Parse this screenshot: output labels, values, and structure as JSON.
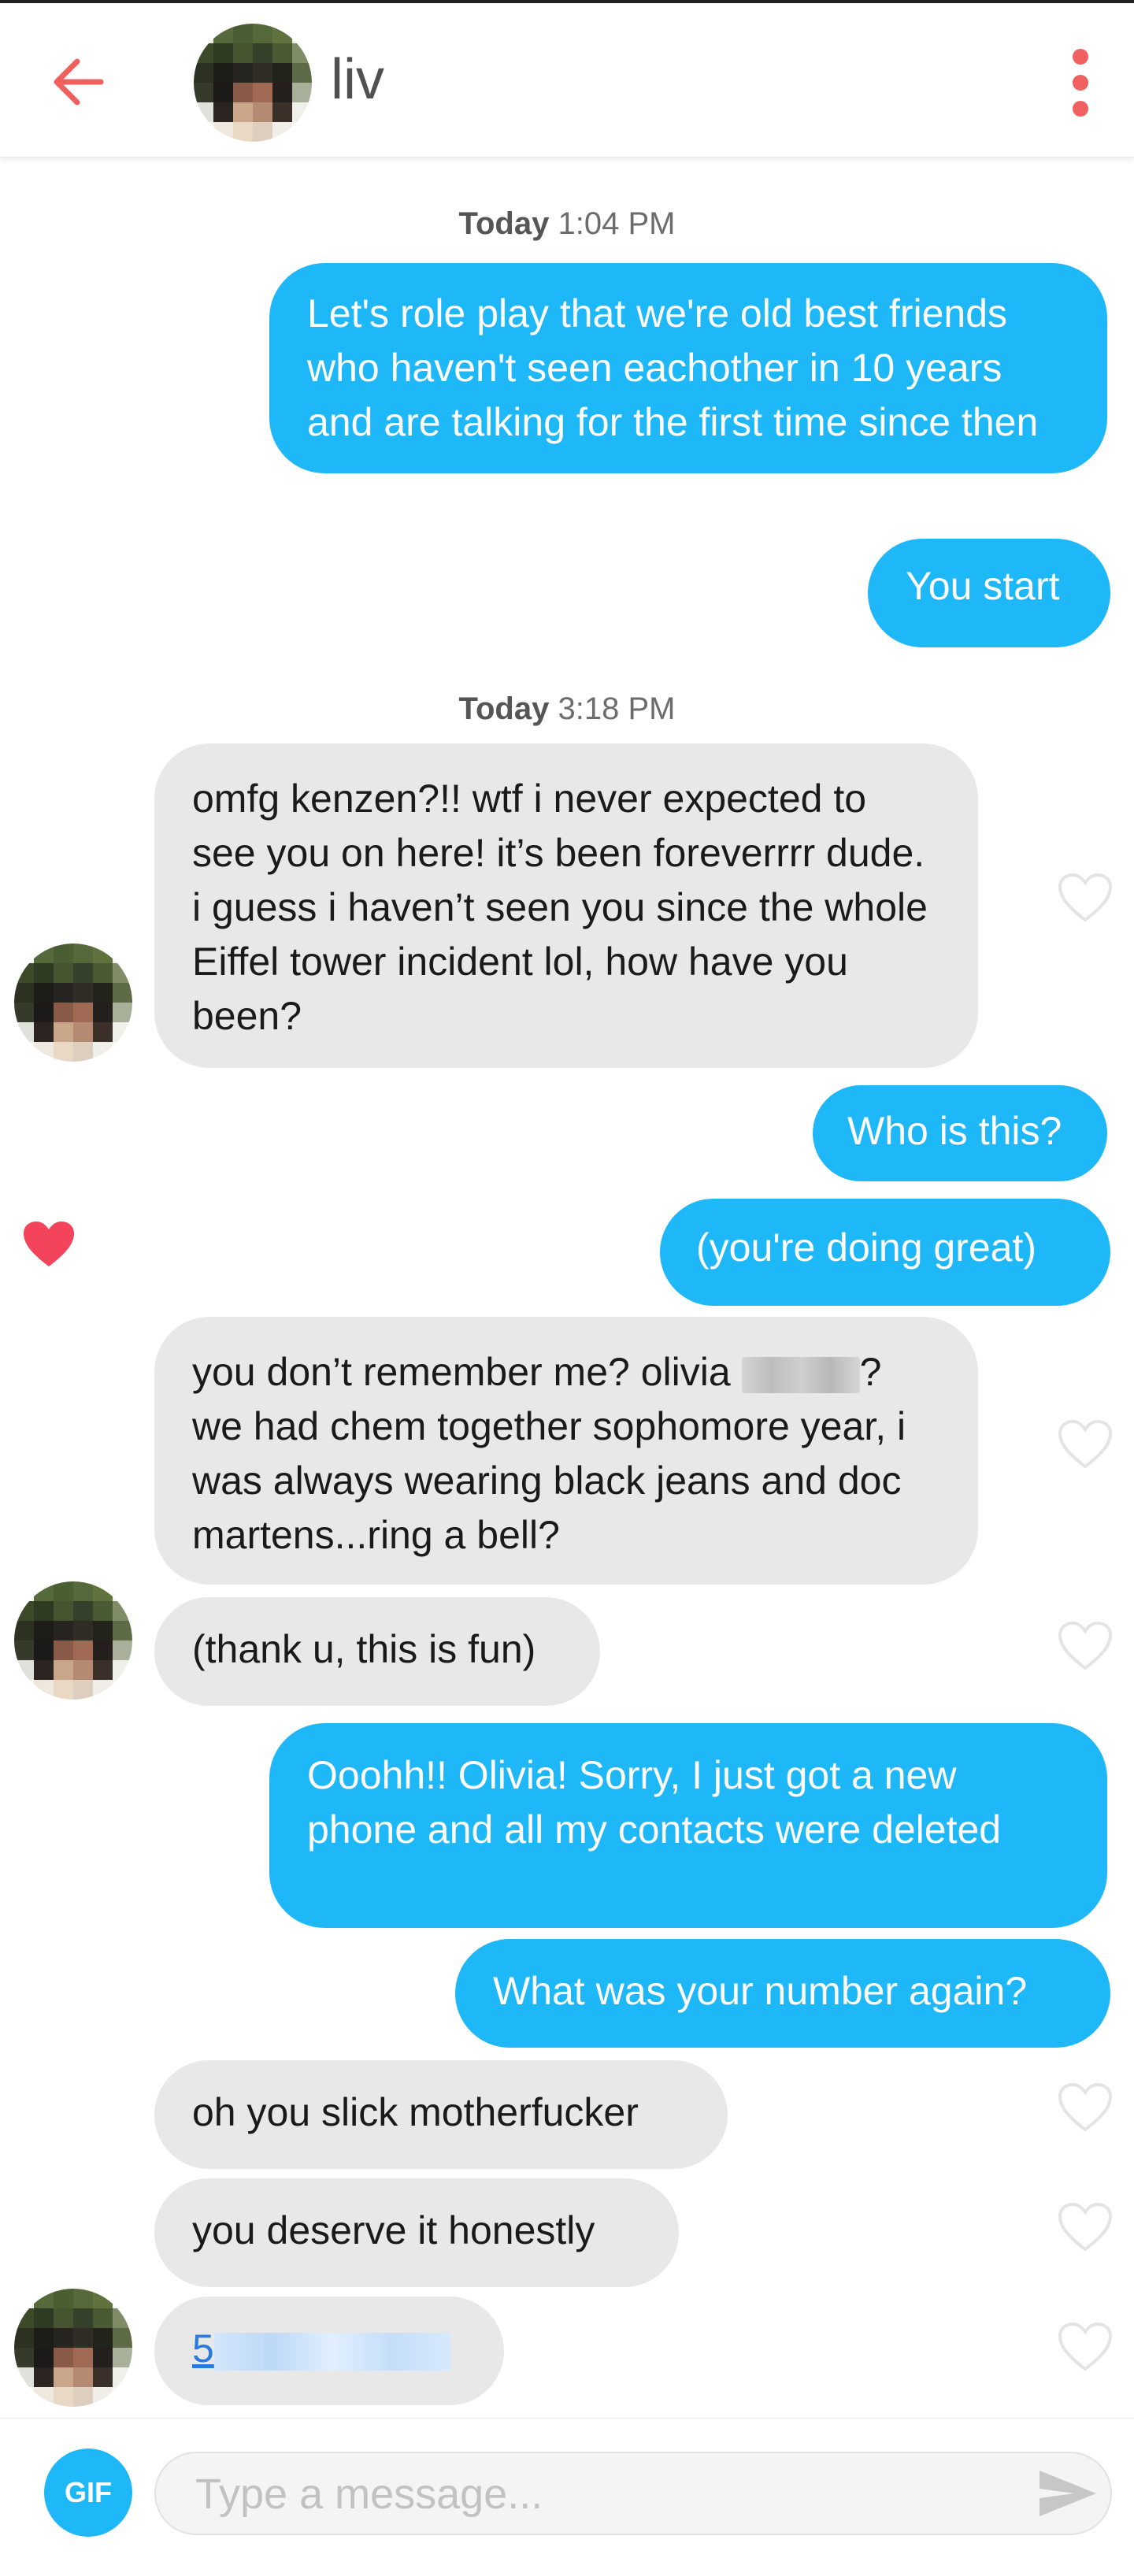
{
  "header": {
    "title": "liv",
    "back_icon": "back-arrow-icon",
    "menu_icon": "kebab-menu-icon",
    "accent": "#f0605f"
  },
  "colors": {
    "outgoing_bubble": "#1eb8f9",
    "incoming_bubble": "#e8e8e8",
    "liked_heart": "#f3445b",
    "unliked_heart": "#e4e4e4"
  },
  "timestamps": [
    {
      "day": "Today",
      "time": "1:04 PM"
    },
    {
      "day": "Today",
      "time": "3:18 PM"
    }
  ],
  "messages": [
    {
      "side": "out",
      "text": "Let's role play that we're old best friends who haven't seen eachother in 10 years and are talking for the first time since then"
    },
    {
      "side": "out",
      "text": "You start"
    },
    {
      "side": "in",
      "text": "omfg kenzen?!! wtf i never expected to see you on here! it’s been foreverrrr dude. i guess i haven’t seen you since the whole Eiffel tower incident lol, how have you been?",
      "liked": false
    },
    {
      "side": "out",
      "text": "Who is this?"
    },
    {
      "side": "out",
      "text": "(you're doing great)",
      "liked": true
    },
    {
      "side": "in",
      "text_before": "you don’t remember me? olivia",
      "text_after": "? we had chem together sophomore year, i was always wearing black jeans and doc martens...ring a bell?",
      "liked": false
    },
    {
      "side": "in",
      "text": "(thank u, this is fun)",
      "liked": false
    },
    {
      "side": "out",
      "text": "Ooohh!! Olivia! Sorry, I just got a new phone and all my contacts were deleted"
    },
    {
      "side": "out",
      "text": "What was your number again?"
    },
    {
      "side": "in",
      "text": "oh you slick motherfucker",
      "liked": false
    },
    {
      "side": "in",
      "text": "you deserve it honestly",
      "liked": false
    },
    {
      "side": "in",
      "text": "5",
      "liked": false
    }
  ],
  "composer": {
    "gif_label": "GIF",
    "placeholder": "Type a message...",
    "send_icon": "send-icon"
  }
}
